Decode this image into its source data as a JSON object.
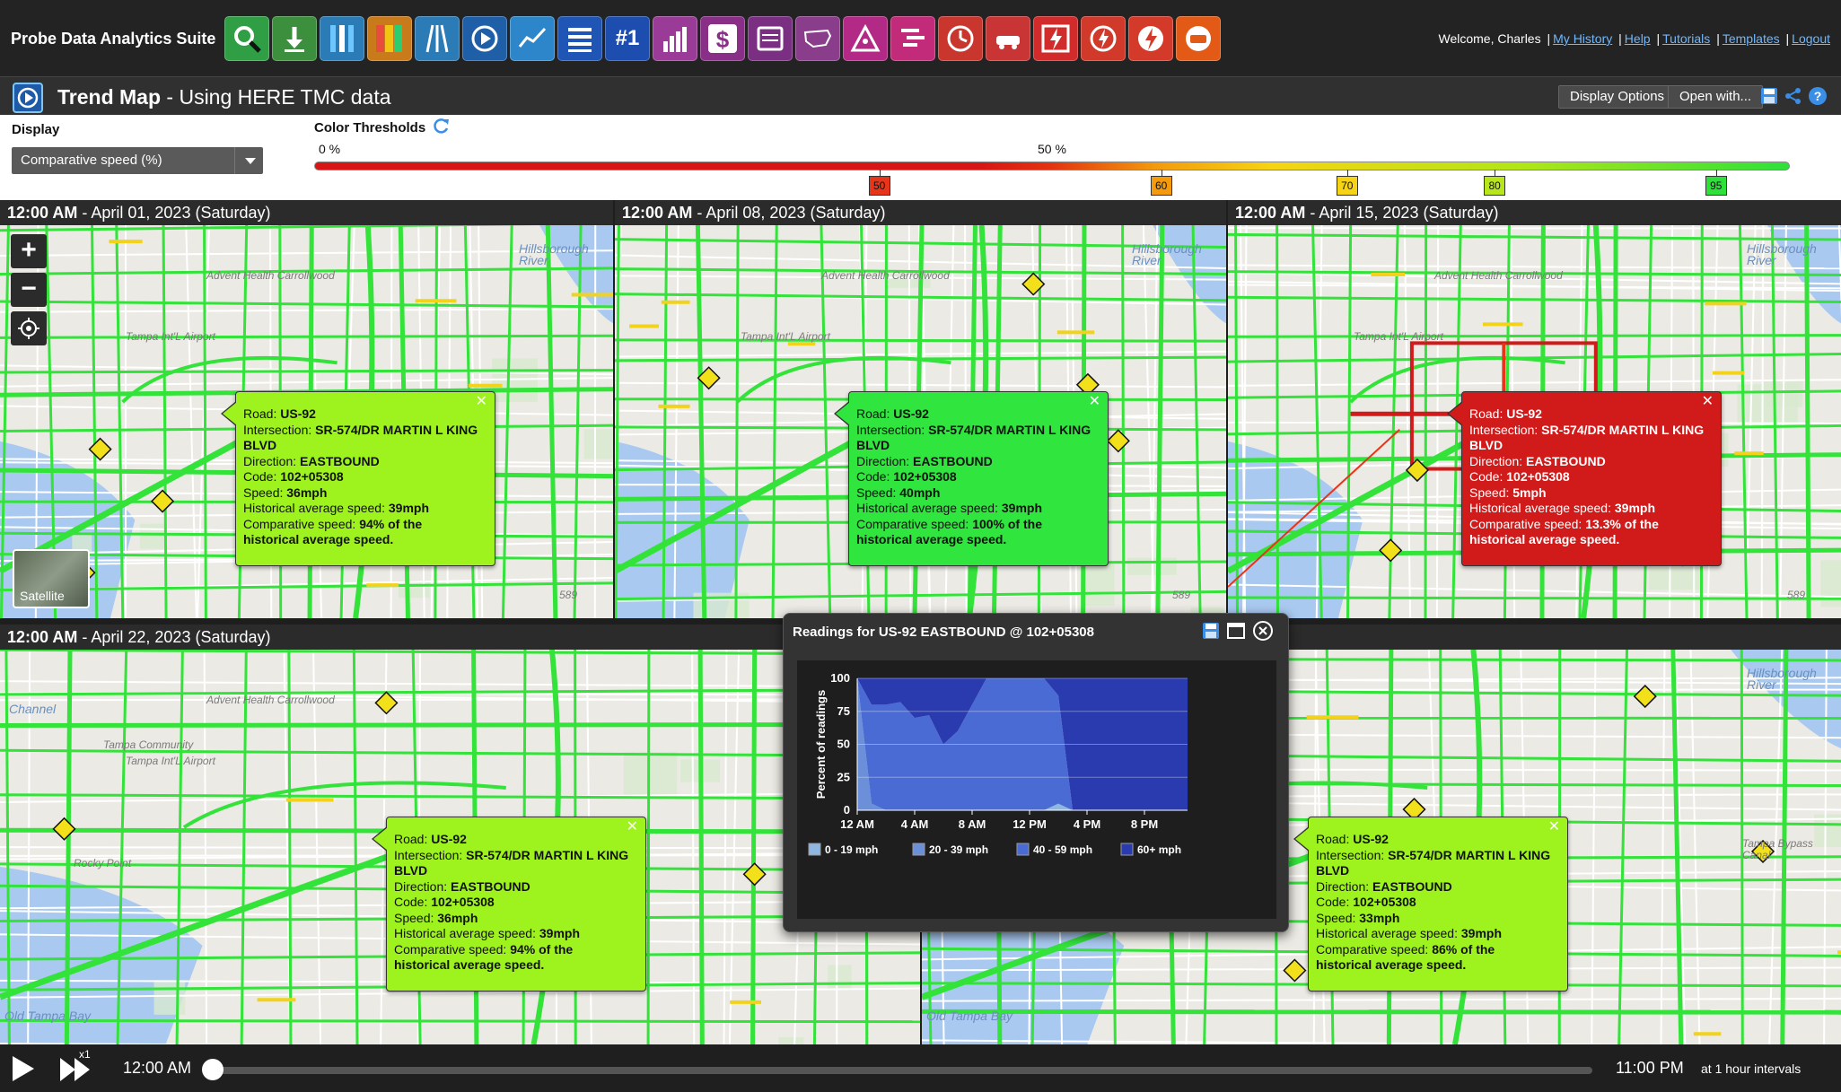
{
  "app": {
    "title": "Probe Data Analytics Suite"
  },
  "toolbar": {
    "tools": [
      {
        "name": "search-tool",
        "color": "#2f9e44",
        "icon": "magnifier-icon"
      },
      {
        "name": "download-tool",
        "color": "#3c8f3c",
        "icon": "download-icon"
      },
      {
        "name": "congestion-scan-tool",
        "color": "#2a7bb6",
        "icon": "road-bars-icon"
      },
      {
        "name": "bottleneck-tool",
        "color": "#c97a1a",
        "icon": "colored-grid-icon"
      },
      {
        "name": "trend-tool",
        "color": "#2a7bb6",
        "icon": "road-lines-icon"
      },
      {
        "name": "trend-map-tool",
        "color": "#1e5fa8",
        "icon": "play-circle-icon"
      },
      {
        "name": "performance-chart-tool",
        "color": "#2d86c9",
        "icon": "line-chart-icon"
      },
      {
        "name": "list-tool",
        "color": "#1f55b5",
        "icon": "list-icon"
      },
      {
        "name": "ranking-tool",
        "color": "#1e4db0",
        "icon": "number-one-icon",
        "text": "#1"
      },
      {
        "name": "bar-chart-tool",
        "color": "#9a3c97",
        "icon": "bar-chart-icon"
      },
      {
        "name": "user-delay-cost-tool",
        "color": "#8a2f88",
        "icon": "dollar-icon"
      },
      {
        "name": "report-tool",
        "color": "#7a2f82",
        "icon": "report-icon"
      },
      {
        "name": "national-map-tool",
        "color": "#8a3d8a",
        "icon": "usa-map-icon"
      },
      {
        "name": "analysis-tool",
        "color": "#b32a86",
        "icon": "triangle-icon"
      },
      {
        "name": "timeline-tool",
        "color": "#c22b7a",
        "icon": "timeline-icon"
      },
      {
        "name": "clock-tool",
        "color": "#c9362d",
        "icon": "clock-icon"
      },
      {
        "name": "incident-tool",
        "color": "#c93434",
        "icon": "car-icon"
      },
      {
        "name": "event-tool",
        "color": "#d12b2b",
        "icon": "event-icon"
      },
      {
        "name": "speed-tool",
        "color": "#d1392b",
        "icon": "gauge-icon"
      },
      {
        "name": "alert-tool",
        "color": "#d33a2a",
        "icon": "lightning-icon"
      },
      {
        "name": "vehicle-tool",
        "color": "#e35a16",
        "icon": "vehicle-icon"
      }
    ]
  },
  "user": {
    "welcome": "Welcome, Charles",
    "links": [
      "My History",
      "Help",
      "Tutorials",
      "Templates",
      "Logout"
    ]
  },
  "titlebar": {
    "title_bold": "Trend Map",
    "title_rest": " - Using HERE TMC data",
    "display_options": "Display Options",
    "open_with": "Open with..."
  },
  "controls": {
    "display_label": "Display",
    "display_value": "Comparative speed (%)",
    "thresholds_label": "Color Thresholds",
    "scale_start": "0 %",
    "scale_mid": "50 %",
    "markers": [
      {
        "value": "50",
        "pos": 0.383,
        "color": "#e8351a"
      },
      {
        "value": "60",
        "pos": 0.574,
        "color": "#f39a0d"
      },
      {
        "value": "70",
        "pos": 0.7,
        "color": "#f6d413"
      },
      {
        "value": "80",
        "pos": 0.8,
        "color": "#b7e61d"
      },
      {
        "value": "95",
        "pos": 0.95,
        "color": "#2de13a"
      }
    ]
  },
  "panels": [
    {
      "time": "12:00 AM",
      "date": " - April 01, 2023 (Saturday)",
      "popup": {
        "road": "US-92",
        "intersection": "SR-574/DR MARTIN L KING BLVD",
        "direction": "EASTBOUND",
        "code": "102+05308",
        "speed": "36mph",
        "hist": "39mph",
        "comp": "94% of the",
        "comp2": "historical average speed.",
        "color": "#9ef21e"
      }
    },
    {
      "time": "12:00 AM",
      "date": " - April 08, 2023 (Saturday)",
      "popup": {
        "road": "US-92",
        "intersection": "SR-574/DR MARTIN L KING BLVD",
        "direction": "EASTBOUND",
        "code": "102+05308",
        "speed": "40mph",
        "hist": "39mph",
        "comp": "100% of the",
        "comp2": "historical average speed.",
        "color": "#2fe53e"
      }
    },
    {
      "time": "12:00 AM",
      "date": " - April 15, 2023 (Saturday)",
      "popup": {
        "road": "US-92",
        "intersection": "SR-574/DR MARTIN L KING BLVD",
        "direction": "EASTBOUND",
        "code": "102+05308",
        "speed": "5mph",
        "hist": "39mph",
        "comp": "13.3% of the",
        "comp2": "historical average speed.",
        "color": "#d11a1a"
      }
    },
    {
      "time": "12:00 AM",
      "date": " - April 22, 2023 (Saturday)",
      "popup": {
        "road": "US-92",
        "intersection": "SR-574/DR MARTIN L KING BLVD",
        "direction": "EASTBOUND",
        "code": "102+05308",
        "speed": "36mph",
        "hist": "39mph",
        "comp": "94% of the",
        "comp2": "historical average speed.",
        "color": "#9ef21e"
      }
    },
    {
      "time": "",
      "date": "",
      "popup": {
        "road": "US-92",
        "intersection": "SR-574/DR MARTIN L KING BLVD",
        "direction": "EASTBOUND",
        "code": "102+05308",
        "speed": "33mph",
        "hist": "39mph",
        "comp": "86% of the",
        "comp2": "historical average speed.",
        "color": "#9ef21e"
      }
    }
  ],
  "popup_labels": {
    "road": "Road: ",
    "intersection": "Intersection: ",
    "direction": "Direction: ",
    "code": "Code: ",
    "speed": "Speed: ",
    "hist": "Historical average speed: ",
    "comp": "Comparative speed: "
  },
  "map_labels": {
    "hillsborough_river": "Hillsborough River",
    "airport": "Tampa Int'L Airport",
    "adventhealth": "Advent Health Carrollwood",
    "tampa_community": "Tampa Community",
    "rocky_point": "Rocky Point",
    "old_tampa_bay": "Old Tampa Bay",
    "channel": "Channel",
    "bypass_canal": "Tampa Bypass Canal",
    "route_589": "589"
  },
  "satellite": "Satellite",
  "readings": {
    "title": "Readings for US-92 EASTBOUND @ 102+05308",
    "chart_data": {
      "type": "area",
      "ylabel": "Percent of readings",
      "ylim": [
        0,
        100
      ],
      "x_ticks": [
        "12 AM",
        "4 AM",
        "8 AM",
        "12 PM",
        "4 PM",
        "8 PM"
      ],
      "y_ticks": [
        0,
        25,
        50,
        75,
        100
      ],
      "hours": [
        0,
        1,
        2,
        3,
        4,
        5,
        6,
        7,
        8,
        9,
        10,
        11,
        12,
        13,
        14,
        15,
        16,
        17,
        18,
        19,
        20,
        21,
        22,
        23
      ],
      "series": [
        {
          "name": "0 - 19 mph",
          "color": "#8fb7e2",
          "values": [
            0,
            0,
            0,
            0,
            0,
            0,
            0,
            0,
            0,
            0,
            0,
            0,
            0,
            0,
            5,
            0,
            0,
            0,
            0,
            0,
            0,
            0,
            0,
            0
          ]
        },
        {
          "name": "20 - 39 mph",
          "color": "#6b8fd9",
          "values": [
            100,
            5,
            0,
            0,
            0,
            0,
            0,
            0,
            0,
            0,
            0,
            0,
            0,
            0,
            0,
            0,
            0,
            0,
            0,
            0,
            0,
            0,
            0,
            0
          ]
        },
        {
          "name": "40 - 59 mph",
          "color": "#4a6bd4",
          "values": [
            0,
            75,
            80,
            82,
            70,
            72,
            50,
            60,
            80,
            100,
            100,
            100,
            100,
            100,
            82,
            0,
            0,
            0,
            0,
            0,
            0,
            0,
            0,
            0
          ]
        },
        {
          "name": "60+ mph",
          "color": "#2a3bb0",
          "values": [
            0,
            20,
            20,
            18,
            30,
            28,
            50,
            40,
            20,
            0,
            0,
            0,
            0,
            0,
            13,
            100,
            100,
            100,
            100,
            100,
            100,
            100,
            100,
            100
          ]
        }
      ]
    }
  },
  "playback": {
    "speed": "x1",
    "start": "12:00 AM",
    "end": "11:00 PM",
    "interval": "at 1 hour intervals",
    "progress": 0
  }
}
